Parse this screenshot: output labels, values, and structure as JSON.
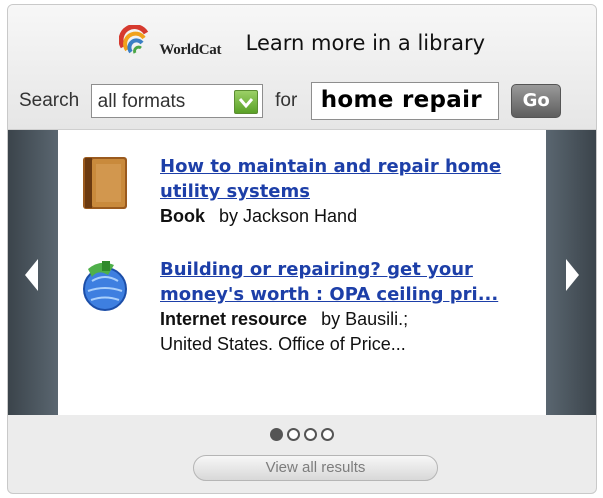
{
  "header": {
    "logo_text": "WorldCat",
    "tagline": "Learn more in a library"
  },
  "search": {
    "search_label": "Search",
    "format_value": "all formats",
    "for_label": "for",
    "query_value": "home repair",
    "go_label": "Go"
  },
  "results": [
    {
      "title_line1": "How to maintain and repair home",
      "title_line2": "utility systems",
      "format": "Book",
      "author_line1": "by Jackson Hand",
      "author_line2": "",
      "thumbnail_icon": "book-icon"
    },
    {
      "title_line1": "Building or repairing? get your",
      "title_line2": "money's worth : OPA ceiling pri...",
      "format": "Internet resource",
      "author_line1": "by Bausili.;",
      "author_line2": "United States. Office of Price...",
      "thumbnail_icon": "globe-icon"
    }
  ],
  "pager": {
    "total_pages": 4,
    "active_page": 1
  },
  "footer": {
    "view_all_label": "View all results"
  },
  "colors": {
    "link": "#1d3fa8",
    "carousel_frame": "#4f5a63",
    "go_button": "#6e6e6e"
  }
}
